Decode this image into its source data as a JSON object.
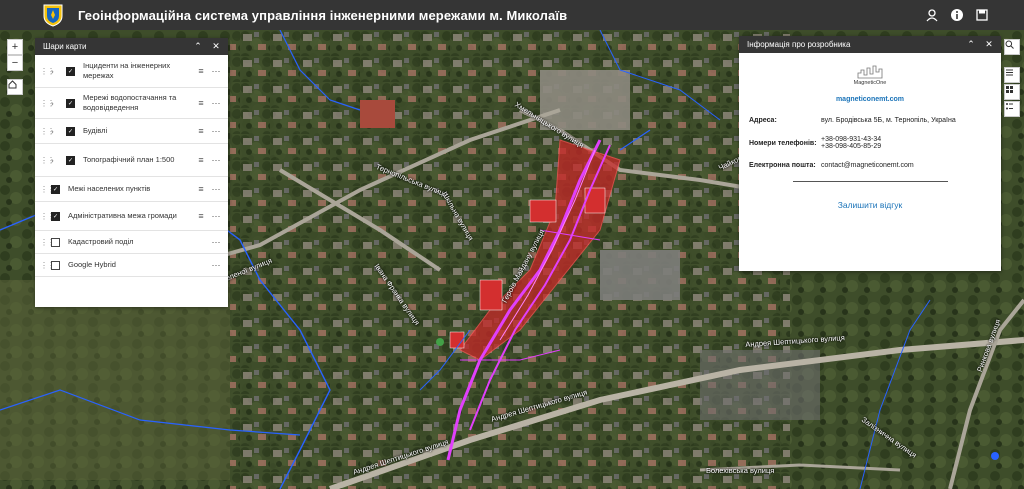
{
  "header": {
    "title": "Геоінформаційна система управління інженерними мережами м. Миколаїв"
  },
  "layers_panel": {
    "title": "Шари карти",
    "layers": [
      {
        "label": "Інциденти на інженерних мережах",
        "checked": true,
        "expandable": true
      },
      {
        "label": "Мережі водопостачання та водовідведення",
        "checked": true,
        "expandable": true
      },
      {
        "label": "Будівлі",
        "checked": true,
        "expandable": true
      },
      {
        "label": "Топографічний план 1:500",
        "checked": true,
        "expandable": true
      },
      {
        "label": "Межі населених пунктів",
        "checked": true,
        "expandable": false
      },
      {
        "label": "Адміністративна межа громади",
        "checked": true,
        "expandable": false
      },
      {
        "label": "Кадастровий поділ",
        "checked": false,
        "expandable": false
      },
      {
        "label": "Google Hybrid",
        "checked": false,
        "expandable": false
      }
    ]
  },
  "info_panel": {
    "title": "Інформація про розробника",
    "logo_text": "MagneticOne",
    "website": "magneticonemt.com",
    "address_label": "Адреса:",
    "address_value": "вул. Бродівська 5Б, м. Тернопіль, Україна",
    "phones_label": "Номери телефонів:",
    "phone1": "+38-098-931-43-34",
    "phone2": "+38-098-405-85-29",
    "email_label": "Електронна пошта:",
    "email_value": "contact@magneticonemt.com",
    "feedback_link": "Залишити відгук"
  },
  "map": {
    "street_labels": [
      "Тернопільська вулиця",
      "Шкільна вулиця",
      "Хмельницького вулиця",
      "Івана Франка вулиця",
      "Андрея Шептицького вулиця",
      "Андрея Шептицького вулиця",
      "Андрея Шептицького вулиця",
      "Ринкова вулиця",
      "Залізнична вулиця",
      "Чайковського вулиця",
      "Болехівська вулиця",
      "Зеленої вулиця",
      "Героїв Майдану вулиця"
    ]
  },
  "colors": {
    "header_bg": "#353535",
    "link": "#1a73b8",
    "parcel_red": "#d32f2f",
    "network_magenta": "#e040fb",
    "boundary_blue": "#2962ff"
  }
}
